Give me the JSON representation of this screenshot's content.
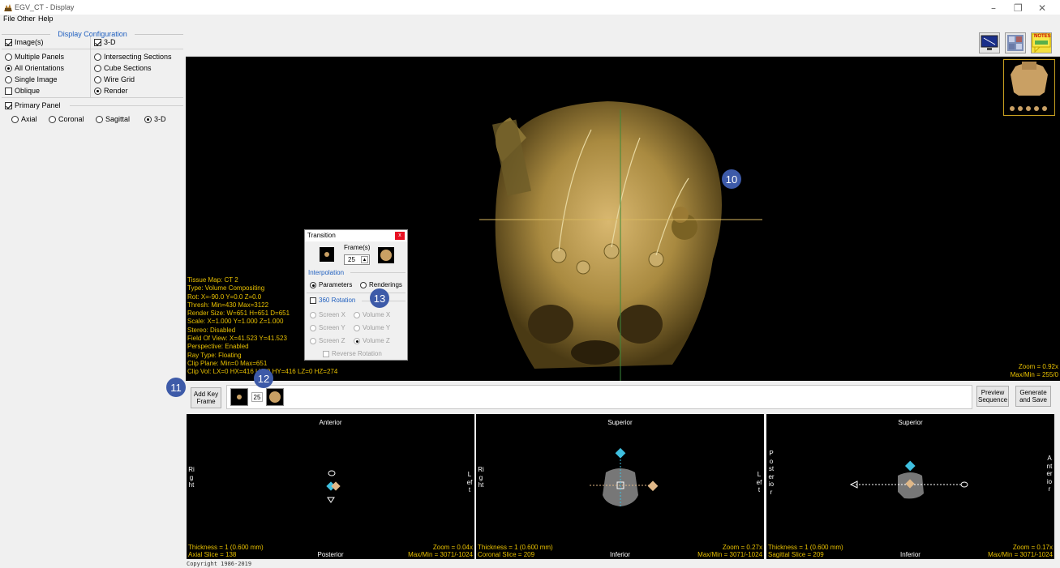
{
  "window": {
    "title": "EGV_CT - Display",
    "minimize": "–",
    "restore": "❐",
    "close": "✕"
  },
  "menu": [
    "File",
    "Other",
    "Help"
  ],
  "display_config": {
    "title": "Display Configuration",
    "images_label": "Image(s)",
    "threed_label": "3-D",
    "left_options": [
      "Multiple Panels",
      "All Orientations",
      "Single Image"
    ],
    "oblique_label": "Oblique",
    "right_options": [
      "Intersecting Sections",
      "Cube Sections",
      "Wire Grid",
      "Render"
    ],
    "primary_panel_label": "Primary Panel",
    "primary_options": [
      "Axial",
      "Coronal",
      "Sagittal",
      "3-D"
    ]
  },
  "toolbar": {
    "icons": [
      "monitor-icon",
      "grid-icon",
      "notes-icon"
    ],
    "notes_label": "NOTES"
  },
  "main_view": {
    "info_lines": [
      "Tissue Map: CT 2",
      "Type: Volume Compositing",
      "Rot: X=-90.0 Y=0.0 Z=0.0",
      "Thresh: Min=430 Max=3122",
      "Render Size: W=651 H=651 D=651",
      "Scale: X=1.000 Y=1.000 Z=1.000",
      "Stereo: Disabled",
      "Field Of View: X=41.523 Y=41.523",
      "Perspective: Enabled",
      "Ray Type: Floating",
      "Clip Plane: Min=0 Max=651",
      "Clip Vol: LX=0 HX=416 LY=0 HY=416 LZ=0 HZ=274"
    ],
    "zoom": "Zoom = 0.92x",
    "maxmin": "Max/Min = 255/0"
  },
  "badges": {
    "b10": "10",
    "b11": "11",
    "b12": "12",
    "b13": "13"
  },
  "transition_dialog": {
    "title": "Transition",
    "close": "x",
    "frames_label": "Frame(s)",
    "frames_value": "25",
    "interpolation_label": "Interpolation",
    "parameters_label": "Parameters",
    "renderings_label": "Renderings",
    "rotation_label": "360 Rotation",
    "screen_x": "Screen X",
    "volume_x": "Volume X",
    "screen_y": "Screen Y",
    "volume_y": "Volume Y",
    "screen_z": "Screen Z",
    "volume_z": "Volume Z",
    "reverse_label": "Reverse Rotation"
  },
  "keyframe_bar": {
    "add_key_frame": "Add Key Frame",
    "frame_count": "25",
    "preview_sequence": "Preview Sequence",
    "generate_and_save": "Generate and Save"
  },
  "panels": [
    {
      "top": "Anterior",
      "bottom": "Posterior",
      "left": "Right",
      "right": "Left",
      "thickness": "Thickness = 1 (0.600 mm)",
      "slice": "Axial Slice = 138",
      "zoom": "Zoom = 0.04x",
      "maxmin": "Max/Min = 3071/-1024"
    },
    {
      "top": "Superior",
      "bottom": "Inferior",
      "left": "Right",
      "right": "Left",
      "thickness": "Thickness = 1 (0.600 mm)",
      "slice": "Coronal Slice = 209",
      "zoom": "Zoom = 0.27x",
      "maxmin": "Max/Min = 3071/-1024"
    },
    {
      "top": "Superior",
      "bottom": "Inferior",
      "left": "Posterior",
      "right": "Anterior",
      "thickness": "Thickness = 1 (0.600 mm)",
      "slice": "Sagittal Slice = 209",
      "zoom": "Zoom = 0.17x",
      "maxmin": "Max/Min = 3071/-1024"
    }
  ],
  "copyright": "Copyright 1986-2019",
  "colors": {
    "accent_blue": "#1f5fbf",
    "overlay_yellow": "#e8c000",
    "badge": "#3d5aa8",
    "marker_cyan": "#3fc0e0",
    "marker_tan": "#e0b888"
  }
}
